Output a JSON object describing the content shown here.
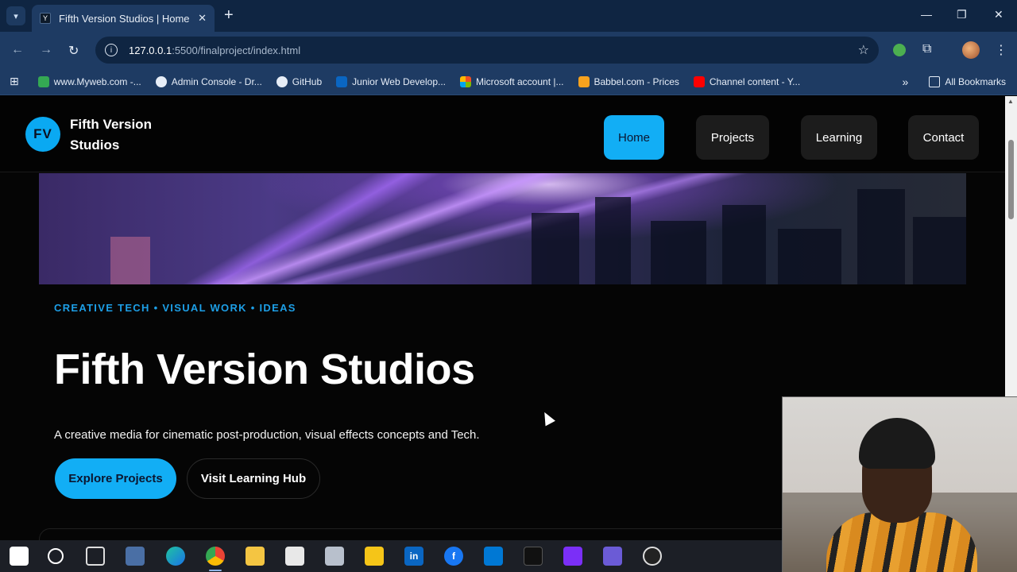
{
  "browser": {
    "tab_title": "Fifth Version Studios | Home",
    "url_host": "127.0.0.1",
    "url_path": ":5500/finalproject/index.html",
    "bookmarks": [
      {
        "label": "www.Myweb.com -...",
        "color": "#34a853"
      },
      {
        "label": "Admin Console - Dr...",
        "color": "#e6edf7"
      },
      {
        "label": "GitHub",
        "color": "#e6edf7"
      },
      {
        "label": "Junior Web Develop...",
        "color": "#0a66c2"
      },
      {
        "label": "Microsoft account |...",
        "color": "#f25022"
      },
      {
        "label": "Babbel.com - Prices",
        "color": "#f6a21e"
      },
      {
        "label": "Channel content - Y...",
        "color": "#ff0000"
      }
    ],
    "all_bookmarks_label": "All Bookmarks"
  },
  "site": {
    "logo_initials": "FV",
    "logo_text": "Fifth Version Studios",
    "nav": [
      {
        "label": "Home",
        "active": true
      },
      {
        "label": "Projects",
        "active": false
      },
      {
        "label": "Learning",
        "active": false
      },
      {
        "label": "Contact",
        "active": false
      }
    ],
    "eyebrow": "CREATIVE TECH • VISUAL WORK • IDEAS",
    "hero_title": "Fifth Version Studios",
    "hero_subtitle": "A creative media for cinematic post-production, visual effects concepts and Tech.",
    "primary_cta": "Explore Projects",
    "secondary_cta": "Visit Learning Hub"
  },
  "colors": {
    "accent": "#12aef5",
    "eyebrow": "#1d9fe6",
    "background": "#050505"
  },
  "taskbar_icons": [
    "windows-icon",
    "search-icon",
    "task-view-icon",
    "widget-icon",
    "edge-icon",
    "chrome-icon",
    "file-explorer-icon",
    "store-icon",
    "app-icon",
    "stocks-icon",
    "linkedin-icon",
    "facebook-icon",
    "vscode-icon",
    "capcut-icon",
    "clipchamp-icon",
    "lab-icon",
    "obs-icon"
  ]
}
